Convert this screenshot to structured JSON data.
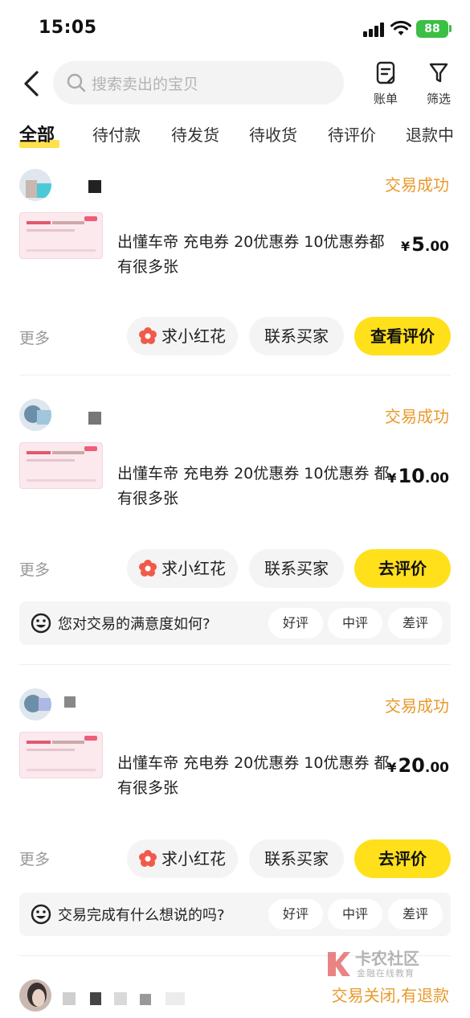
{
  "status_bar": {
    "time": "15:05",
    "battery": "88"
  },
  "header": {
    "search_placeholder": "搜索卖出的宝贝",
    "bill_label": "账单",
    "filter_label": "筛选"
  },
  "tabs": [
    {
      "label": "全部",
      "active": true
    },
    {
      "label": "待付款"
    },
    {
      "label": "待发货"
    },
    {
      "label": "待收货"
    },
    {
      "label": "待评价"
    },
    {
      "label": "退款中"
    }
  ],
  "orders": [
    {
      "status": "交易成功",
      "title": "出懂车帝 充电券 20优惠券 10优惠券都有很多张",
      "price_currency": "¥",
      "price_int": "5",
      "price_dec": ".00",
      "more": "更多",
      "btn_flower": "求小红花",
      "btn_contact": "联系买家",
      "btn_primary": "查看评价"
    },
    {
      "status": "交易成功",
      "title": "出懂车帝 充电券 20优惠券 10优惠券 都有很多张",
      "price_currency": "¥",
      "price_int": "10",
      "price_dec": ".00",
      "more": "更多",
      "btn_flower": "求小红花",
      "btn_contact": "联系买家",
      "btn_primary": "去评价",
      "survey": {
        "question": "您对交易的满意度如何?",
        "good": "好评",
        "neutral": "中评",
        "bad": "差评"
      }
    },
    {
      "status": "交易成功",
      "title": "出懂车帝 充电券 20优惠券 10优惠券 都有很多张",
      "price_currency": "¥",
      "price_int": "20",
      "price_dec": ".00",
      "more": "更多",
      "btn_flower": "求小红花",
      "btn_contact": "联系买家",
      "btn_primary": "去评价",
      "survey": {
        "question": "交易完成有什么想说的吗?",
        "good": "好评",
        "neutral": "中评",
        "bad": "差评"
      }
    },
    {
      "status": "交易关闭,有退款"
    }
  ],
  "watermark": {
    "title": "卡农社区",
    "subtitle": "金融在线教育"
  },
  "colors": {
    "accent_yellow": "#ffe01b",
    "status_orange": "#e89a2c",
    "flower_red": "#f05a4a"
  }
}
